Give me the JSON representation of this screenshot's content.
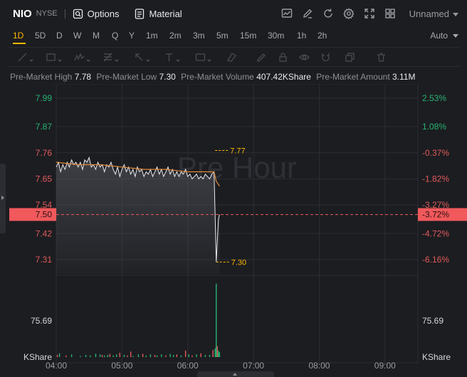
{
  "header": {
    "symbol": "NIO",
    "exchange": "NYSE",
    "options_label": "Options",
    "material_label": "Material",
    "layout_name": "Unnamed"
  },
  "intervals": [
    "1D",
    "5D",
    "D",
    "W",
    "M",
    "Q",
    "Y",
    "1m",
    "2m",
    "3m",
    "5m",
    "15m",
    "30m",
    "1h",
    "2h"
  ],
  "active_interval": "1D",
  "scale_mode": "Auto",
  "premarket": {
    "high_label": "Pre-Market High",
    "high_value": "7.78",
    "low_label": "Pre-Market Low",
    "low_value": "7.30",
    "volume_label": "Pre-Market Volume",
    "volume_value": "407.42KShare",
    "amount_label": "Pre-Market Amount",
    "amount_value": "3.11M"
  },
  "chart_data": {
    "type": "line",
    "watermark": "Pre Hour",
    "price_ticks": [
      {
        "price": 7.99,
        "label": "7.99",
        "pct": "2.53%"
      },
      {
        "price": 7.87,
        "label": "7.87",
        "pct": "1.08%"
      },
      {
        "price": 7.76,
        "label": "7.76",
        "pct": "-0.37%"
      },
      {
        "price": 7.65,
        "label": "7.65",
        "pct": "-1.82%"
      },
      {
        "price": 7.54,
        "label": "7.54",
        "pct": "-3.27%"
      },
      {
        "price": 7.42,
        "label": "7.42",
        "pct": "-4.72%"
      },
      {
        "price": 7.31,
        "label": "7.31",
        "pct": "-6.16%"
      }
    ],
    "ylim": [
      7.25,
      8.05
    ],
    "current_price": {
      "label": "7.50",
      "pct": "-3.72%",
      "value": 7.5
    },
    "high_marker": {
      "label": "7.77",
      "value": 7.77
    },
    "low_marker": {
      "label": "7.30",
      "value": 7.3
    },
    "x_ticks": [
      "04:00",
      "05:00",
      "06:00",
      "07:00",
      "08:00",
      "09:00"
    ],
    "x_range_minutes": [
      0,
      330
    ],
    "price_series": [
      [
        0,
        7.7
      ],
      [
        2,
        7.72
      ],
      [
        4,
        7.68
      ],
      [
        6,
        7.71
      ],
      [
        8,
        7.69
      ],
      [
        10,
        7.72
      ],
      [
        12,
        7.7
      ],
      [
        14,
        7.73
      ],
      [
        16,
        7.71
      ],
      [
        18,
        7.72
      ],
      [
        20,
        7.7
      ],
      [
        22,
        7.72
      ],
      [
        24,
        7.69
      ],
      [
        26,
        7.73
      ],
      [
        28,
        7.72
      ],
      [
        30,
        7.74
      ],
      [
        32,
        7.7
      ],
      [
        34,
        7.71
      ],
      [
        36,
        7.69
      ],
      [
        38,
        7.72
      ],
      [
        40,
        7.7
      ],
      [
        42,
        7.71
      ],
      [
        44,
        7.68
      ],
      [
        46,
        7.71
      ],
      [
        48,
        7.7
      ],
      [
        50,
        7.72
      ],
      [
        52,
        7.69
      ],
      [
        54,
        7.67
      ],
      [
        56,
        7.7
      ],
      [
        58,
        7.66
      ],
      [
        60,
        7.69
      ],
      [
        62,
        7.71
      ],
      [
        64,
        7.68
      ],
      [
        66,
        7.7
      ],
      [
        68,
        7.67
      ],
      [
        70,
        7.69
      ],
      [
        72,
        7.66
      ],
      [
        74,
        7.7
      ],
      [
        76,
        7.68
      ],
      [
        78,
        7.69
      ],
      [
        80,
        7.66
      ],
      [
        82,
        7.68
      ],
      [
        84,
        7.67
      ],
      [
        86,
        7.69
      ],
      [
        88,
        7.66
      ],
      [
        90,
        7.68
      ],
      [
        92,
        7.7
      ],
      [
        94,
        7.67
      ],
      [
        96,
        7.69
      ],
      [
        98,
        7.66
      ],
      [
        100,
        7.68
      ],
      [
        102,
        7.7
      ],
      [
        104,
        7.67
      ],
      [
        106,
        7.69
      ],
      [
        108,
        7.66
      ],
      [
        110,
        7.68
      ],
      [
        112,
        7.66
      ],
      [
        114,
        7.68
      ],
      [
        116,
        7.67
      ],
      [
        118,
        7.69
      ],
      [
        120,
        7.66
      ],
      [
        122,
        7.67
      ],
      [
        124,
        7.65
      ],
      [
        126,
        7.66
      ],
      [
        128,
        7.67
      ],
      [
        130,
        7.65
      ],
      [
        132,
        7.66
      ],
      [
        134,
        7.65
      ],
      [
        136,
        7.67
      ],
      [
        138,
        7.66
      ],
      [
        140,
        7.65
      ],
      [
        142,
        7.67
      ],
      [
        144,
        7.68
      ],
      [
        146,
        7.3
      ],
      [
        148,
        7.48
      ],
      [
        149,
        7.5
      ]
    ],
    "avg_series": [
      [
        0,
        7.72
      ],
      [
        20,
        7.71
      ],
      [
        40,
        7.71
      ],
      [
        60,
        7.7
      ],
      [
        80,
        7.69
      ],
      [
        100,
        7.69
      ],
      [
        120,
        7.68
      ],
      [
        140,
        7.68
      ],
      [
        144,
        7.68
      ],
      [
        146,
        7.64
      ],
      [
        149,
        7.62
      ]
    ],
    "volume_tick": "75.69",
    "volume_unit": "KShare",
    "volume_max": 140,
    "volume_series": [
      [
        1,
        4
      ],
      [
        3,
        7
      ],
      [
        9,
        3
      ],
      [
        14,
        5
      ],
      [
        22,
        2
      ],
      [
        27,
        4
      ],
      [
        31,
        3
      ],
      [
        36,
        6
      ],
      [
        40,
        5
      ],
      [
        42,
        4
      ],
      [
        44,
        3
      ],
      [
        47,
        4
      ],
      [
        49,
        6
      ],
      [
        52,
        3
      ],
      [
        55,
        5
      ],
      [
        58,
        8
      ],
      [
        62,
        4
      ],
      [
        65,
        3
      ],
      [
        68,
        10
      ],
      [
        70,
        2
      ],
      [
        75,
        5
      ],
      [
        79,
        6
      ],
      [
        82,
        3
      ],
      [
        86,
        5
      ],
      [
        90,
        4
      ],
      [
        92,
        3
      ],
      [
        96,
        5
      ],
      [
        100,
        3
      ],
      [
        104,
        6
      ],
      [
        107,
        4
      ],
      [
        110,
        5
      ],
      [
        114,
        3
      ],
      [
        118,
        12
      ],
      [
        121,
        5
      ],
      [
        124,
        3
      ],
      [
        128,
        5
      ],
      [
        132,
        7
      ],
      [
        136,
        4
      ],
      [
        140,
        4
      ],
      [
        143,
        13
      ],
      [
        145,
        16
      ],
      [
        146,
        135
      ],
      [
        147,
        20
      ],
      [
        148,
        12
      ],
      [
        149,
        9
      ]
    ],
    "volume_colors": {
      "1": "#e15a5a",
      "3": "#25b472",
      "9": "#e15a5a",
      "14": "#25b472",
      "22": "#25b472",
      "27": "#25b472",
      "31": "#25b472",
      "36": "#25b472",
      "40": "#25b472",
      "42": "#e15a5a",
      "44": "#25b472",
      "47": "#25b472",
      "49": "#e15a5a",
      "52": "#25b472",
      "55": "#25b472",
      "58": "#e15a5a",
      "62": "#25b472",
      "65": "#e15a5a",
      "68": "#e15a5a",
      "70": "#25b472",
      "75": "#25b472",
      "79": "#e15a5a",
      "82": "#25b472",
      "86": "#25b472",
      "90": "#e15a5a",
      "92": "#25b472",
      "96": "#25b472",
      "100": "#e15a5a",
      "104": "#25b472",
      "107": "#25b472",
      "110": "#e15a5a",
      "114": "#25b472",
      "118": "#e15a5a",
      "121": "#25b472",
      "124": "#e15a5a",
      "128": "#25b472",
      "132": "#e15a5a",
      "136": "#25b472",
      "140": "#25b472",
      "143": "#e15a5a",
      "145": "#25b472",
      "146": "#25b472",
      "147": "#e15a5a",
      "148": "#25b472",
      "149": "#25b472"
    }
  },
  "colors": {
    "up": "#25b472",
    "down": "#e15a5a",
    "current_price_bg": "#f1595c",
    "accent": "#ffb800",
    "avg_line": "#e08a3a"
  }
}
